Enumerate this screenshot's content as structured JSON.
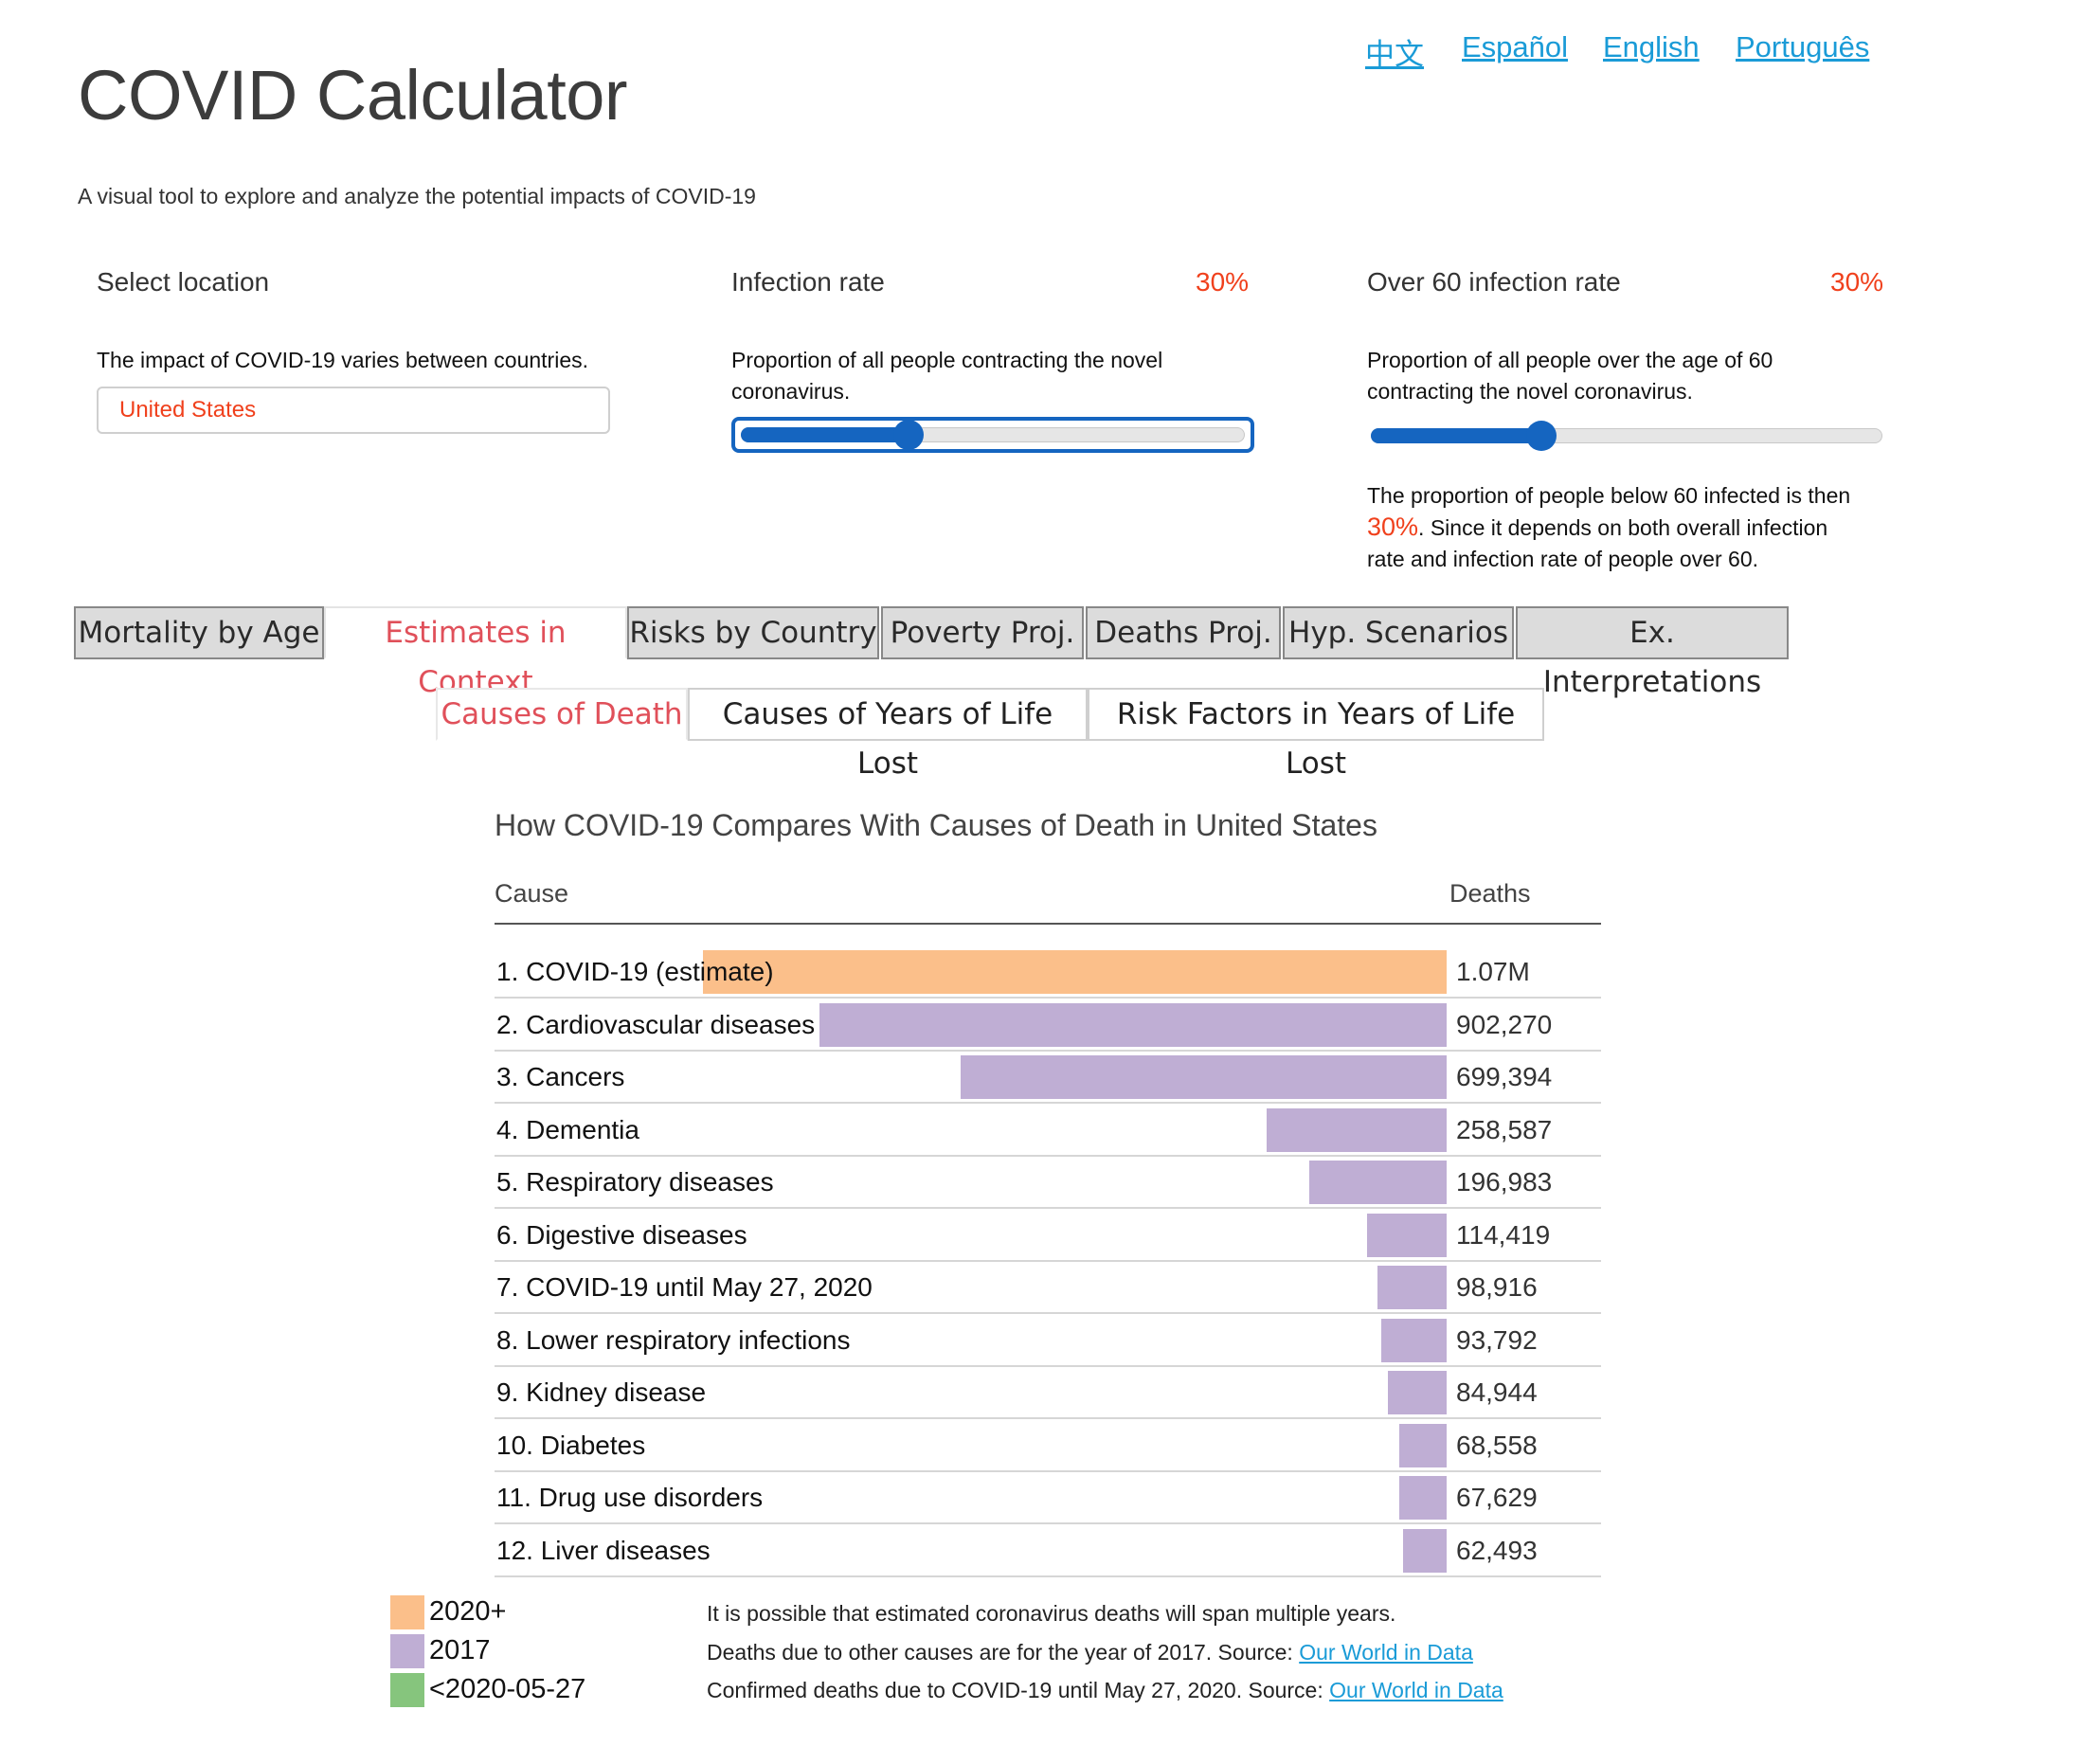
{
  "languages": [
    "中文",
    "Español",
    "English",
    "Português"
  ],
  "header": {
    "title": "COVID Calculator",
    "subtitle": "A visual tool to explore and analyze the potential impacts of COVID-19"
  },
  "controls": {
    "location": {
      "label": "Select location",
      "description": "The impact of COVID-19 varies between countries.",
      "value": "United States"
    },
    "infection_rate": {
      "label": "Infection rate",
      "value": "30%",
      "description_line1": "Proportion of all people contracting the novel",
      "description_line2": "coronavirus.",
      "fraction": 0.3
    },
    "over60_rate": {
      "label": "Over 60 infection rate",
      "value": "30%",
      "description_line1": "Proportion of all people over the age of 60",
      "description_line2": "contracting the novel coronavirus.",
      "fraction": 0.3,
      "note_line1": "The proportion of people below 60 infected is then",
      "note_value": "30%",
      "note_line2": ". Since it depends on both overall infection",
      "note_line3": "rate and infection rate of people over 60."
    }
  },
  "tabs": [
    "Mortality by Age",
    "Estimates in Context",
    "Risks by Country",
    "Poverty Proj.",
    "Deaths Proj.",
    "Hyp. Scenarios",
    "Ex. Interpretations"
  ],
  "active_tab": "Estimates in Context",
  "subtabs": [
    "Causes of Death",
    "Causes of Years of Life Lost",
    "Risk Factors in Years of Life Lost"
  ],
  "active_subtab": "Causes of Death",
  "colors": {
    "estimate": "#fbbf8a",
    "y2017": "#bfaed4",
    "confirmed": "#86c57d",
    "accent": "#f0401c",
    "tab_active": "#e0505a",
    "slider": "#1565c0",
    "link": "#1a9bd7"
  },
  "chart_data": {
    "type": "bar",
    "title": "How COVID-19 Compares With Causes of Death in United States",
    "column_headers": [
      "Cause",
      "Deaths"
    ],
    "rows": [
      {
        "label": "1. COVID-19 (estimate)",
        "value": 1070000,
        "display": "1.07M",
        "series": "2020+"
      },
      {
        "label": "2. Cardiovascular diseases",
        "value": 902270,
        "display": "902,270",
        "series": "2017"
      },
      {
        "label": "3. Cancers",
        "value": 699394,
        "display": "699,394",
        "series": "2017"
      },
      {
        "label": "4. Dementia",
        "value": 258587,
        "display": "258,587",
        "series": "2017"
      },
      {
        "label": "5. Respiratory diseases",
        "value": 196983,
        "display": "196,983",
        "series": "2017"
      },
      {
        "label": "6. Digestive diseases",
        "value": 114419,
        "display": "114,419",
        "series": "2017"
      },
      {
        "label": "7. COVID-19 until May 27, 2020",
        "value": 98916,
        "display": "98,916",
        "series": "2017"
      },
      {
        "label": "8. Lower respiratory infections",
        "value": 93792,
        "display": "93,792",
        "series": "2017"
      },
      {
        "label": "9. Kidney disease",
        "value": 84944,
        "display": "84,944",
        "series": "2017"
      },
      {
        "label": "10. Diabetes",
        "value": 68558,
        "display": "68,558",
        "series": "2017"
      },
      {
        "label": "11. Drug use disorders",
        "value": 67629,
        "display": "67,629",
        "series": "2017"
      },
      {
        "label": "12. Liver diseases",
        "value": 62493,
        "display": "62,493",
        "series": "2017"
      }
    ],
    "legend": [
      "2020+",
      "2017",
      "<2020-05-27"
    ]
  },
  "footnotes": {
    "line1": "It is possible that estimated coronavirus deaths will span multiple years.",
    "line2": "Deaths due to other causes are for the year of 2017. Source: ",
    "line3": "Confirmed deaths due to COVID-19 until May 27, 2020. Source: ",
    "source_link": "Our World in Data"
  }
}
